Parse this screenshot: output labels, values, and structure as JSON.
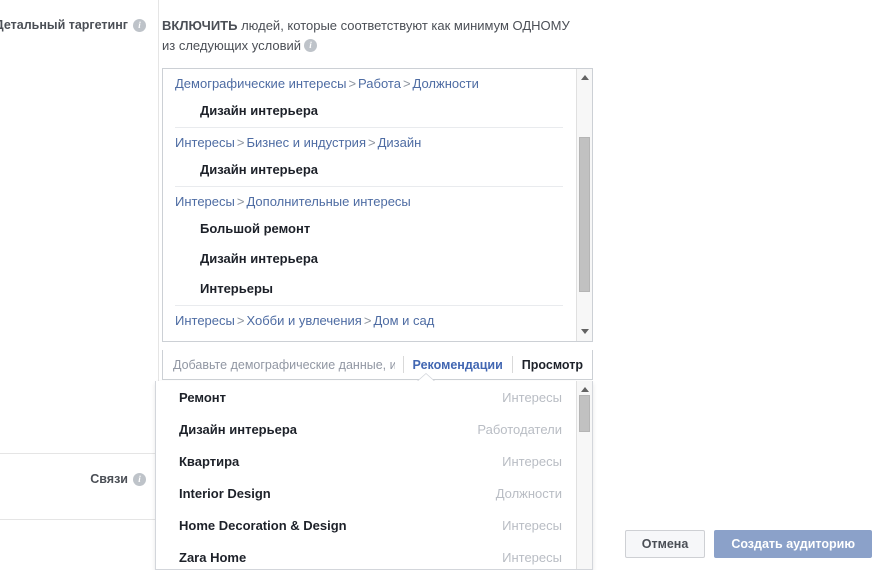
{
  "labels": {
    "detailed_targeting": "Детальный таргетинг",
    "connections": "Связи",
    "info_glyph": "i"
  },
  "instruction": {
    "lead": "ВКЛЮЧИТЬ",
    "rest": " людей, которые соответствуют как минимум ОДНОМУ из следующих условий"
  },
  "selection": {
    "groups": [
      {
        "path": [
          "Демографические интересы",
          "Работа",
          "Должности"
        ],
        "items": [
          "Дизайн интерьера"
        ]
      },
      {
        "path": [
          "Интересы",
          "Бизнес и индустрия",
          "Дизайн"
        ],
        "items": [
          "Дизайн интерьера"
        ]
      },
      {
        "path": [
          "Интересы",
          "Дополнительные интересы"
        ],
        "items": [
          "Большой ремонт",
          "Дизайн интерьера",
          "Интерьеры"
        ]
      },
      {
        "path": [
          "Интересы",
          "Хобби и увлечения",
          "Дом и сад"
        ],
        "items": []
      }
    ],
    "separator": ">"
  },
  "search": {
    "value": "",
    "placeholder": "Добавьте демографические данные, ин..."
  },
  "tabs": [
    {
      "label": "Рекомендации",
      "active": true
    },
    {
      "label": "Просмотр",
      "active": false
    }
  ],
  "suggestions": [
    {
      "name": "Ремонт",
      "type": "Интересы",
      "highlight": false
    },
    {
      "name": "Дизайн интерьера",
      "type": "Работодатели",
      "highlight": false
    },
    {
      "name": "Квартира",
      "type": "Интересы",
      "highlight": false
    },
    {
      "name": "Interior Design",
      "type": "Должности",
      "highlight": true
    },
    {
      "name": "Home Decoration & Design",
      "type": "Интересы",
      "highlight": true
    },
    {
      "name": "Zara Home",
      "type": "Интересы",
      "highlight": false
    }
  ],
  "footer": {
    "cancel": "Отмена",
    "submit": "Создать аудиторию"
  },
  "colors": {
    "link_blue": "#4e6ca3",
    "tab_active": "#4267b2",
    "primary_button": "#8ba1c9",
    "annotation_red": "#f2415a"
  }
}
